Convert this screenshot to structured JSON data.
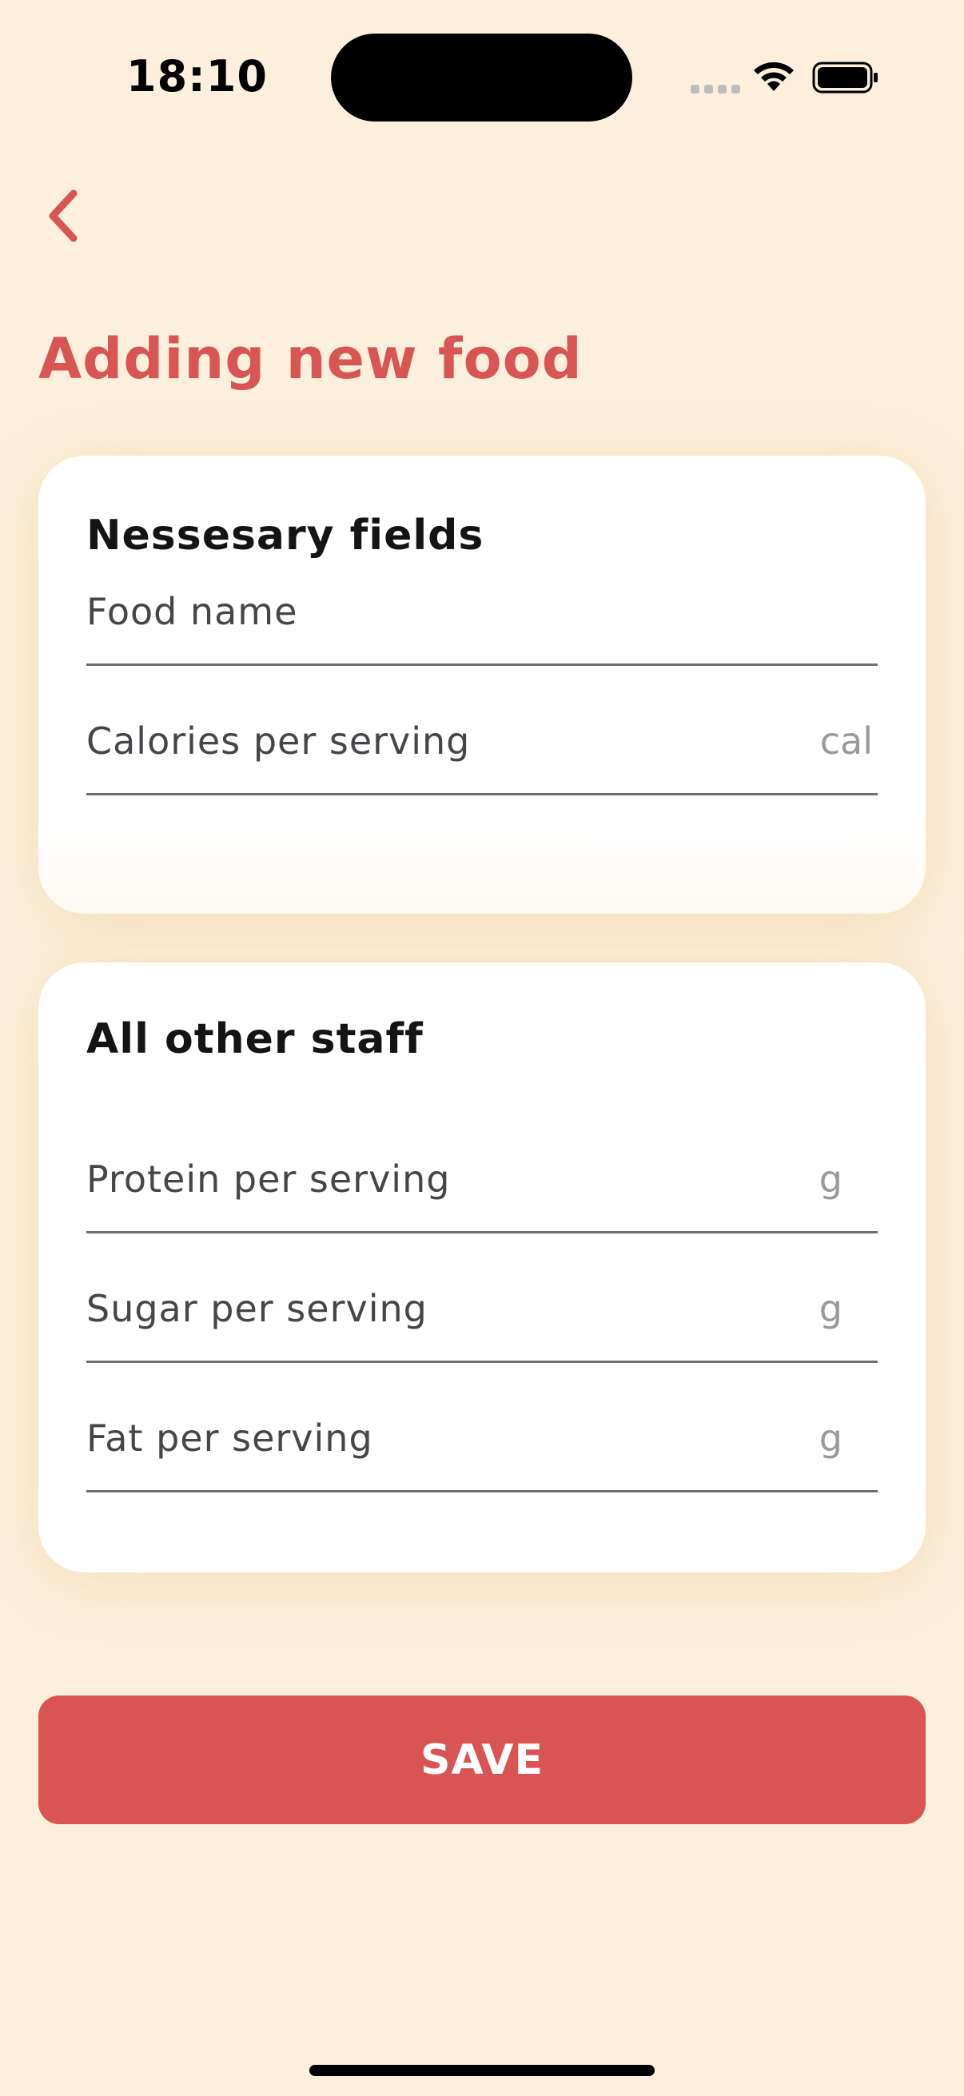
{
  "status_bar": {
    "time": "18:10"
  },
  "header": {
    "title": "Adding new food"
  },
  "necessary_card": {
    "title": "Nessesary fields",
    "fields": [
      {
        "label": "Food name",
        "unit": ""
      },
      {
        "label": "Calories per serving",
        "unit": "cal"
      }
    ]
  },
  "other_card": {
    "title": "All other staff",
    "fields": [
      {
        "label": "Protein per serving",
        "unit": "g"
      },
      {
        "label": "Sugar per serving",
        "unit": "g"
      },
      {
        "label": "Fat per serving",
        "unit": "g"
      }
    ]
  },
  "actions": {
    "save_label": "SAVE"
  },
  "colors": {
    "background": "#fcf0dd",
    "accent": "#d85553",
    "card": "#ffffff"
  },
  "icons": {
    "back": "chevron-left-icon",
    "wifi": "wifi-icon",
    "battery": "battery-icon"
  }
}
